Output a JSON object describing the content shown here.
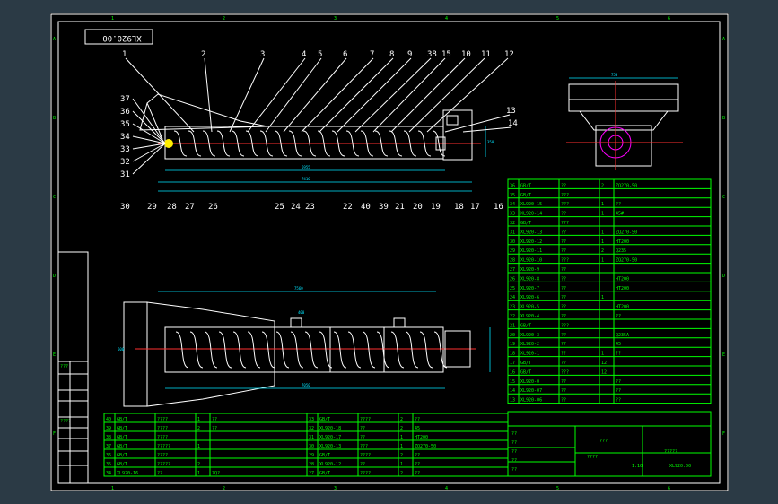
{
  "drawing": {
    "stamp_mirror": "XL920.00",
    "drawing_no": "XL920.00",
    "title_main": "???",
    "title_name": "?????",
    "title_small": "????",
    "scale": "1:10",
    "left_table_top": "???",
    "left_table_mid": "????",
    "title_block_labels": [
      "??",
      "??",
      "??",
      "??",
      "??"
    ],
    "col_markers": [
      "1",
      "2",
      "3",
      "4",
      "5",
      "6"
    ],
    "row_markers": [
      "A",
      "B",
      "C",
      "D",
      "E",
      "F"
    ],
    "dimension_labels": {
      "top_view_length": "7416",
      "top_view_inner": "6955",
      "top_view_pitch": "400",
      "side_length": "7560",
      "side_inner": "7050",
      "side_width": "600",
      "end_width": "750",
      "end_height": "350"
    },
    "part_numbers_top": [
      "1",
      "2",
      "3",
      "4",
      "5",
      "6",
      "7",
      "8",
      "9",
      "38",
      "15",
      "10",
      "11",
      "12",
      "13",
      "14"
    ],
    "part_numbers_left": [
      "37",
      "36",
      "35",
      "34",
      "33",
      "32",
      "31"
    ],
    "part_numbers_bottom": [
      "30",
      "29",
      "28",
      "27",
      "26",
      "25",
      "24",
      "23",
      "22",
      "40",
      "39",
      "21",
      "20",
      "19",
      "18",
      "17",
      "16"
    ]
  },
  "bom_right": [
    [
      "36",
      "GB/T",
      "??",
      "2",
      "ZQ270-50"
    ],
    [
      "35",
      "GB/T",
      "???",
      "",
      ""
    ],
    [
      "34",
      "XL920-15",
      "???",
      "1",
      "??"
    ],
    [
      "33",
      "XL920-14",
      "??",
      "1",
      "45#"
    ],
    [
      "32",
      "GB/T",
      "???",
      "",
      ""
    ],
    [
      "31",
      "XL920-13",
      "??",
      "1",
      "ZQ270-50"
    ],
    [
      "30",
      "XL920-12",
      "??",
      "1",
      "HT200"
    ],
    [
      "29",
      "XL920-11",
      "??",
      "2",
      "Q235"
    ],
    [
      "28",
      "XL920-10",
      "???",
      "1",
      "ZQ270-50"
    ],
    [
      "27",
      "XL920-9",
      "??",
      "",
      ""
    ],
    [
      "26",
      "XL920-8",
      "??",
      "",
      "HT200"
    ],
    [
      "25",
      "XL920-7",
      "??",
      "",
      "HT200"
    ],
    [
      "24",
      "XL920-6",
      "??",
      "1",
      ""
    ],
    [
      "23",
      "XL920-5",
      "??",
      "",
      "HT200"
    ],
    [
      "22",
      "XL920-4",
      "??",
      "",
      "??"
    ],
    [
      "21",
      "GB/T",
      "???",
      "",
      ""
    ],
    [
      "20",
      "XL920-3",
      "??",
      "",
      "Q235A"
    ],
    [
      "19",
      "XL920-2",
      "??",
      "",
      "45"
    ],
    [
      "18",
      "XL920-1",
      "??",
      "1",
      "??"
    ],
    [
      "17",
      "GB/T",
      "??",
      "12",
      ""
    ],
    [
      "16",
      "GB/T",
      "???",
      "12",
      ""
    ],
    [
      "15",
      "XL920-0",
      "??",
      "",
      "??"
    ],
    [
      "14",
      "XL920-07",
      "??",
      "",
      "??"
    ],
    [
      "13",
      "XL920-06",
      "??",
      "",
      "??"
    ]
  ],
  "bom_bottom_left": [
    [
      "40",
      "GB/T",
      "????",
      "1",
      "??"
    ],
    [
      "39",
      "GB/T",
      "????",
      "2",
      "??"
    ],
    [
      "38",
      "GB/T",
      "????",
      "",
      ""
    ],
    [
      "37",
      "GB/T",
      "?????",
      "1",
      ""
    ],
    [
      "36",
      "GB/T",
      "????",
      "",
      ""
    ],
    [
      "35",
      "GB/T",
      "?????",
      "2",
      ""
    ],
    [
      "34",
      "XL920-16",
      "??",
      "1",
      "ZQ?"
    ]
  ],
  "bom_bottom_right": [
    [
      "33",
      "GB/T",
      "????",
      "2",
      "??"
    ],
    [
      "32",
      "XL920-18",
      "??",
      "2",
      "45"
    ],
    [
      "31",
      "XL920-17",
      "??",
      "1",
      "HT200"
    ],
    [
      "30",
      "XL920-13",
      "???",
      "1",
      "ZQ270-50"
    ],
    [
      "29",
      "GB/T",
      "????",
      "2",
      "??"
    ],
    [
      "28",
      "XL920-12",
      "??",
      "1",
      "??"
    ],
    [
      "27",
      "GB/T",
      "????",
      "2",
      "??"
    ]
  ]
}
